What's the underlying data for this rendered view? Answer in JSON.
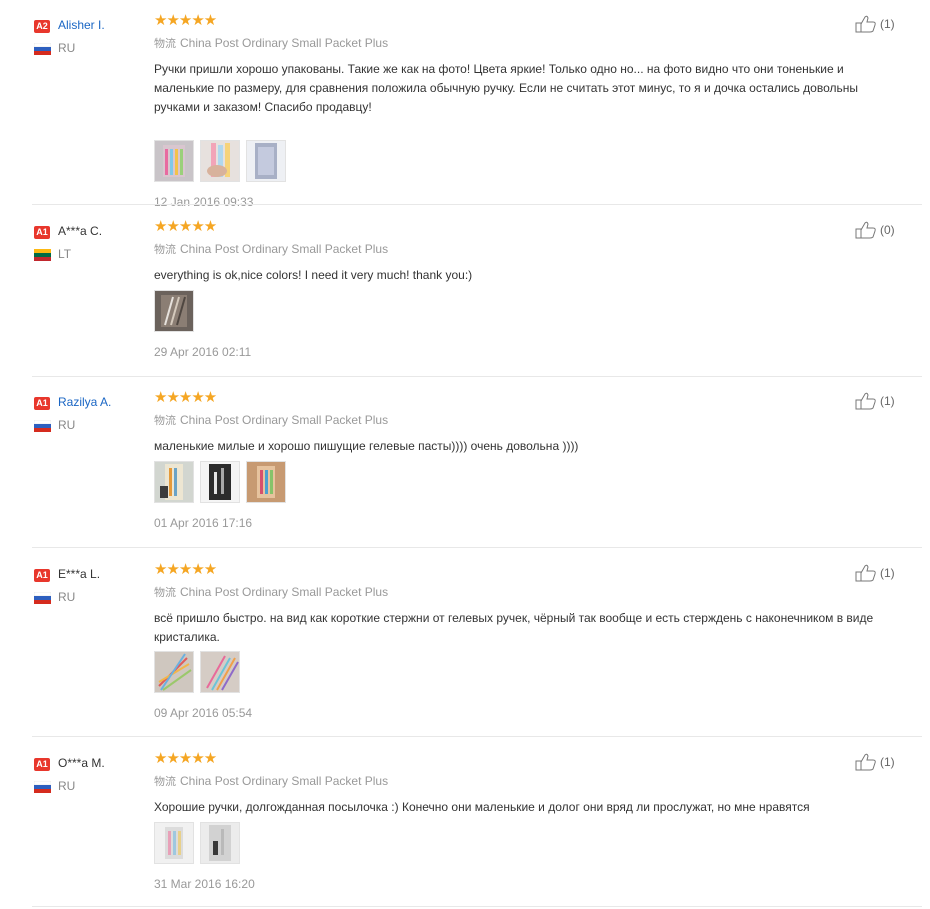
{
  "reviews": [
    {
      "level": "A2",
      "name": "Alisher I.",
      "name_link": true,
      "country": "RU",
      "stars": "★★★★★",
      "logistics_cn": "物流",
      "logistics": "China Post Ordinary Small Packet Plus",
      "text": "Ручки пришли хорошо упакованы. Такие же как на фото! Цвета яркие! Только одно но... на фото видно что они тоненькие и маленькие по размеру, для сравнения положила обычную ручку. Если не считать этот минус, то я и дочка остались довольны ручками и заказом! Спасибо продавцу!",
      "date": "12 Jan 2016 09:33",
      "helpful": "(1)",
      "photos": [
        "photo-pens-pink",
        "photo-pens-hand",
        "photo-pens-packet"
      ]
    },
    {
      "level": "A1",
      "name": "A***a C.",
      "name_link": false,
      "country": "LT",
      "stars": "★★★★★",
      "logistics_cn": "物流",
      "logistics": "China Post Ordinary Small Packet Plus",
      "text": "everything is ok,nice colors! I need it very much! thank you:)",
      "date": "29 Apr 2016 02:11",
      "helpful": "(0)",
      "photos": [
        "photo-pens-dark"
      ]
    },
    {
      "level": "A1",
      "name": "Razilya A.",
      "name_link": true,
      "country": "RU",
      "stars": "★★★★★",
      "logistics_cn": "物流",
      "logistics": "China Post Ordinary Small Packet Plus",
      "text": "маленькие милые и хорошо пишущие гелевые пасты)))) очень довольна ))))",
      "date": "01 Apr 2016 17:16",
      "helpful": "(1)",
      "photos": [
        "photo-pens-box",
        "photo-pens-black",
        "photo-pens-wood"
      ]
    },
    {
      "level": "A1",
      "name": "E***a L.",
      "name_link": false,
      "country": "RU",
      "stars": "★★★★★",
      "logistics_cn": "物流",
      "logistics": "China Post Ordinary Small Packet Plus",
      "text": "всё пришло быстро. на вид как короткие стержни от гелевых ручек, чёрный так вообще и есть стерждень с наконечником в виде кристалика.",
      "date": "09 Apr 2016 05:54",
      "helpful": "(1)",
      "photos": [
        "photo-refills-fan",
        "photo-refills-row"
      ]
    },
    {
      "level": "A1",
      "name": "O***a M.",
      "name_link": false,
      "country": "RU",
      "stars": "★★★★★",
      "logistics_cn": "物流",
      "logistics": "China Post Ordinary Small Packet Plus",
      "text": "Хорошие ручки, долгожданная посылочка :) Конечно они маленькие и долог они вряд ли прослужат, но мне нравятся",
      "date": "31 Mar 2016 16:20",
      "helpful": "(1)",
      "photos": [
        "photo-pens-light",
        "photo-pens-grey"
      ]
    }
  ]
}
